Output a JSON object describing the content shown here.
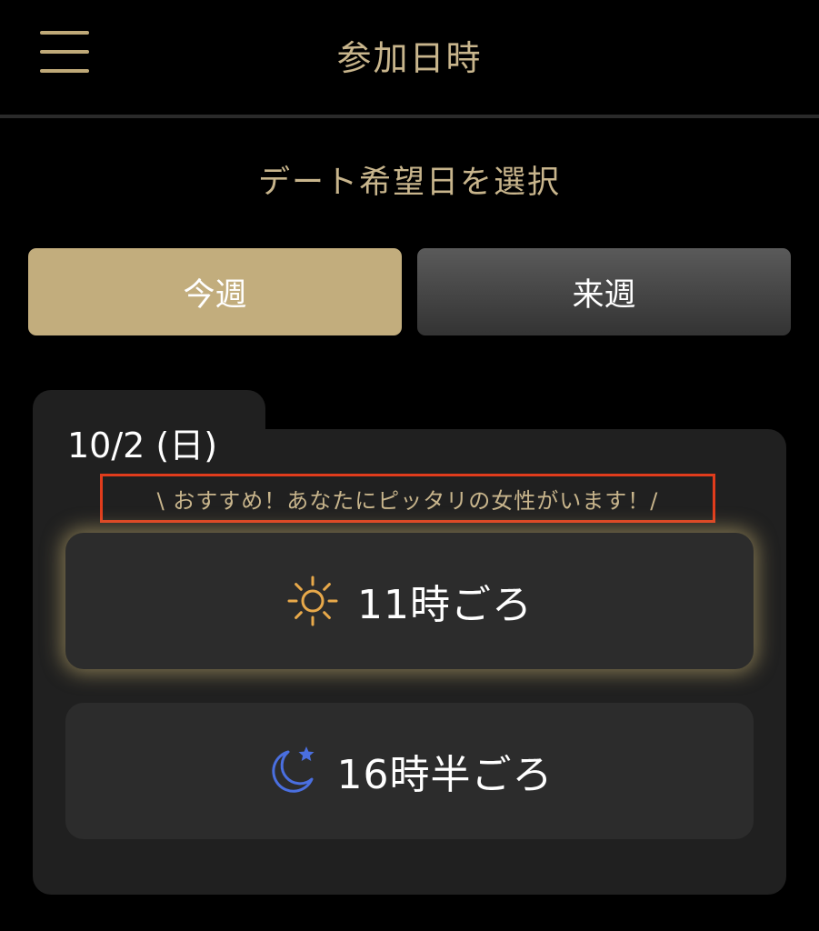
{
  "header": {
    "title": "参加日時",
    "menu_icon": "hamburger-menu-icon"
  },
  "section": {
    "title": "デート希望日を選択"
  },
  "tabs": [
    {
      "label": "今週",
      "selected": true
    },
    {
      "label": "来週",
      "selected": false
    }
  ],
  "card": {
    "date": "10/2 (日)",
    "recommend_text": "\\ おすすめ！あなたにピッタリの女性がいます！/",
    "slots": [
      {
        "label": "11時ごろ",
        "icon": "sun-icon",
        "recommended": true
      },
      {
        "label": "16時半ごろ",
        "icon": "moon-star-icon",
        "recommended": false
      }
    ]
  },
  "colors": {
    "accent_gold": "#c2ad7d",
    "text_gold": "#c8b58c",
    "highlight_border": "#e03c1c",
    "moon_blue": "#4a6fe0",
    "sun_orange": "#e8a94a"
  }
}
